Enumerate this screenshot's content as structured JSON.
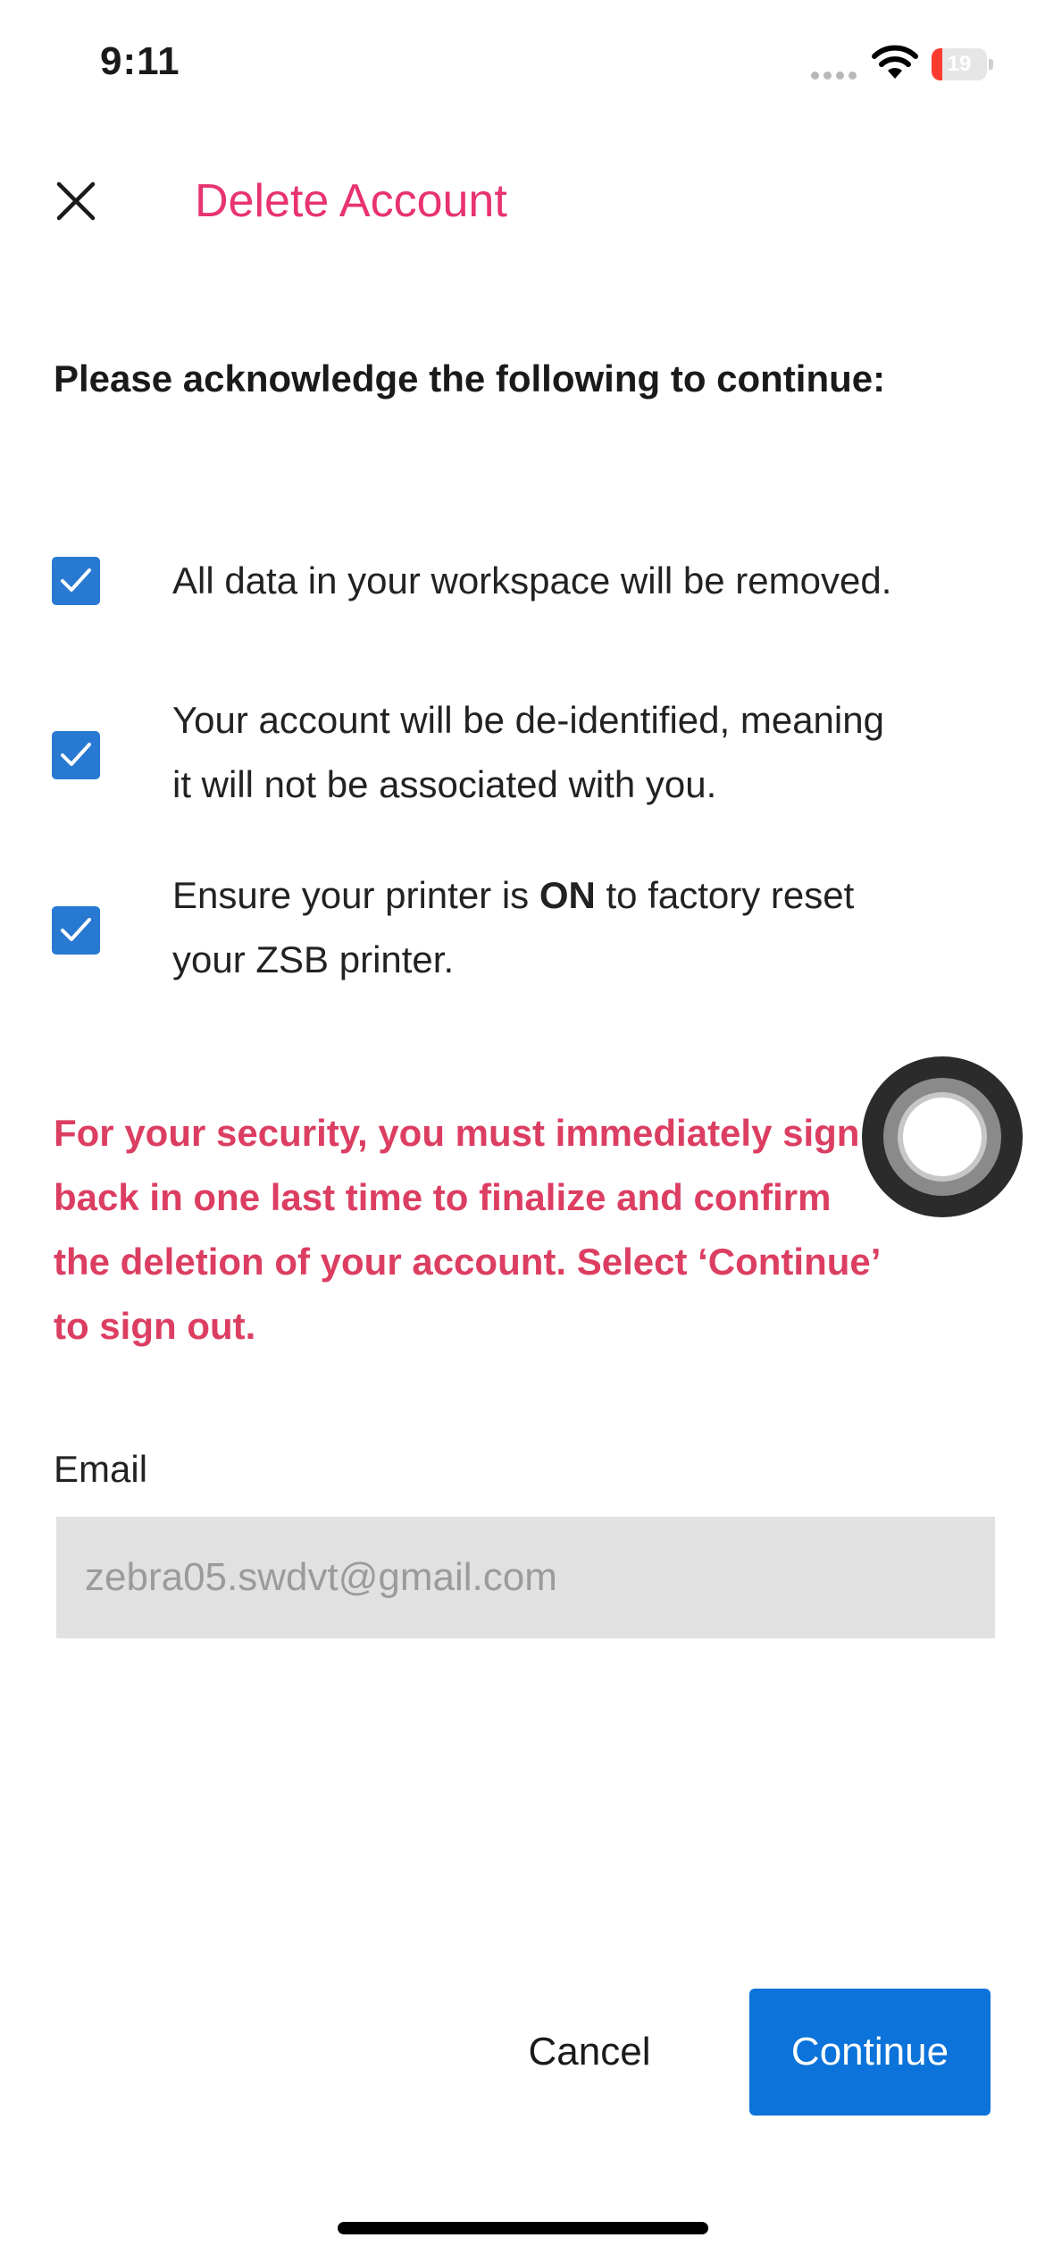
{
  "status_bar": {
    "time": "9:11",
    "battery_level": "19",
    "battery_fraction": 0.19,
    "battery_color": "#ff3b30",
    "icons": [
      "signal-icon",
      "wifi-icon",
      "battery-icon"
    ]
  },
  "header": {
    "title": "Delete Account",
    "close_icon": "close-icon",
    "title_color": "#e8336f"
  },
  "instruction": "Please acknowledge the following to continue:",
  "checklist": [
    {
      "checked": true,
      "line1": "All data in your workspace will be removed.",
      "line2": ""
    },
    {
      "checked": true,
      "line1": "Your account will be de-identified, meaning",
      "line2": "it will not be associated with you."
    },
    {
      "checked": true,
      "prefix": "Ensure your printer is ",
      "bold": "ON",
      "suffix": " to factory reset",
      "line2": "your ZSB printer."
    }
  ],
  "security_note": {
    "lines": [
      "For your security, you must immediately sign",
      "back in one last time to finalize and confirm",
      "the deletion of your account. Select ‘Continue’",
      "to sign out."
    ],
    "color": "#dc3e62"
  },
  "email": {
    "label": "Email",
    "value": "zebra05.swdvt@gmail.com"
  },
  "actions": {
    "cancel_label": "Cancel",
    "continue_label": "Continue",
    "continue_color": "#0b73d9"
  }
}
